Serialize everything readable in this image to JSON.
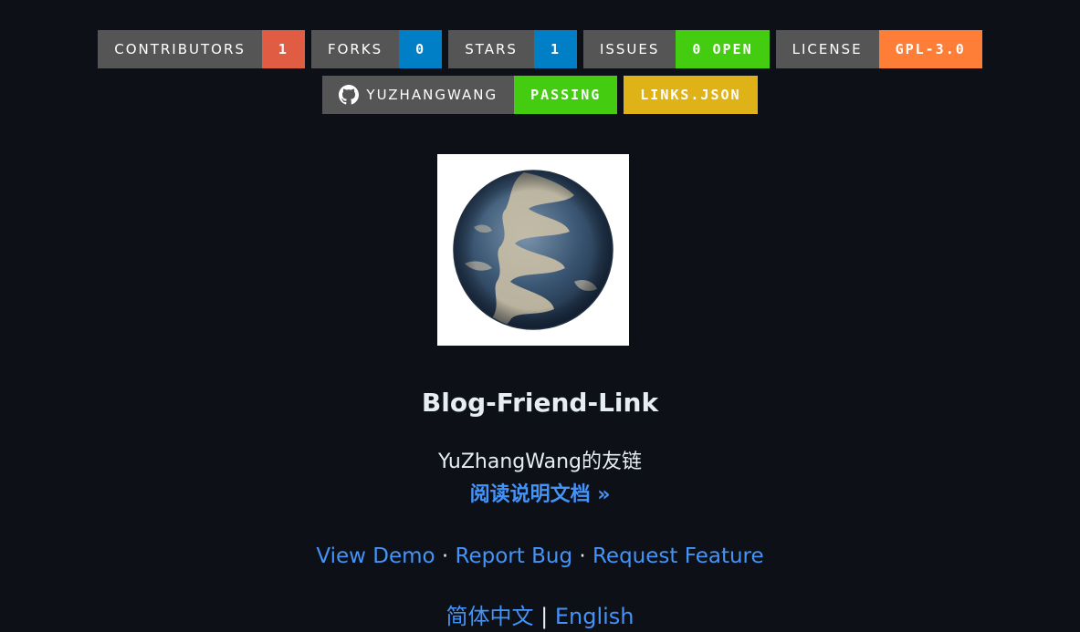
{
  "badges_row1": [
    {
      "label": "CONTRIBUTORS",
      "message": "1",
      "color": "#e05d44"
    },
    {
      "label": "FORKS",
      "message": "0",
      "color": "#007ec6"
    },
    {
      "label": "STARS",
      "message": "1",
      "color": "#007ec6"
    },
    {
      "label": "ISSUES",
      "message": "0 OPEN",
      "color": "#4c1"
    },
    {
      "label": "LICENSE",
      "message": "GPL-3.0",
      "color": "#fe7d37"
    }
  ],
  "badges_row2": [
    {
      "label": "YUZHANGWANG",
      "message": "PASSING",
      "color": "#4c1",
      "icon": "github-icon"
    },
    {
      "message": "LINKS.JSON",
      "color": "#dfb317"
    }
  ],
  "logo": {
    "icon": "globe-logo"
  },
  "title": "Blog-Friend-Link",
  "subtitle": "YuZhangWang的友链",
  "docs_link": "阅读说明文档 »",
  "links": {
    "demo": "View Demo",
    "sep1": " · ",
    "bug": "Report Bug",
    "sep2": " · ",
    "feature": "Request Feature"
  },
  "languages": {
    "zh": "简体中文",
    "sep": " | ",
    "en": "English"
  }
}
